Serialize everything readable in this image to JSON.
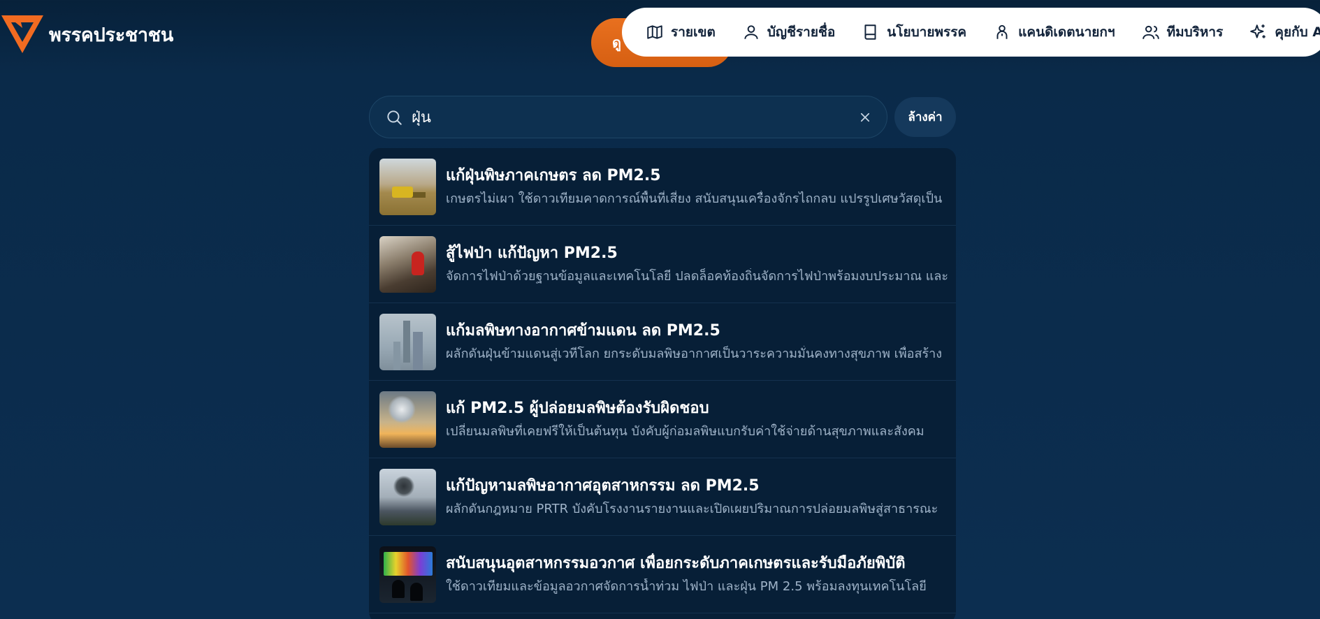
{
  "brand": {
    "name": "พรรคประชาชน",
    "accent": "#f26b21"
  },
  "cta": {
    "label": "ดู"
  },
  "nav": {
    "items": [
      {
        "label": "รายเขต",
        "icon": "map-icon"
      },
      {
        "label": "บัญชีรายชื่อ",
        "icon": "user-icon"
      },
      {
        "label": "นโยบายพรรค",
        "icon": "book-icon"
      },
      {
        "label": "แคนดิเดตนายกฯ",
        "icon": "person-icon"
      },
      {
        "label": "ทีมบริหาร",
        "icon": "users-icon"
      },
      {
        "label": "คุยกับ AI",
        "icon": "sparkles-icon"
      }
    ]
  },
  "search": {
    "value": "ฝุ่น",
    "clear_icon": "close-icon",
    "reset_label": "ล้างค่า"
  },
  "results": [
    {
      "title": "แก้ฝุ่นพิษภาคเกษตร ลด PM2.5",
      "desc": "เกษตรไม่เผา ใช้ดาวเทียมคาดการณ์พื้นที่เสี่ยง สนับสนุนเครื่องจักรไถกลบ แปรรูปเศษวัสดุเป็น",
      "thumb": "agriculture-harvester"
    },
    {
      "title": "สู้ไฟป่า แก้ปัญหา PM2.5",
      "desc": "จัดการไฟป่าด้วยฐานข้อมูลและเทคโนโลยี ปลดล็อคท้องถิ่นจัดการไฟป่าพร้อมงบประมาณ และ",
      "thumb": "forest-fire-fighter"
    },
    {
      "title": "แก้มลพิษทางอากาศข้ามแดน ลด PM2.5",
      "desc": "ผลักดันฝุ่นข้ามแดนสู่เวทีโลก ยกระดับมลพิษอากาศเป็นวาระความมั่นคงทางสุขภาพ เพื่อสร้าง",
      "thumb": "hazy-city-skyline"
    },
    {
      "title": "แก้ PM2.5 ผู้ปล่อยมลพิษต้องรับผิดชอบ",
      "desc": "เปลี่ยนมลพิษที่เคยฟรีให้เป็นต้นทุน บังคับผู้ก่อมลพิษแบกรับค่าใช้จ่ายด้านสุขภาพและสังคม",
      "thumb": "smokestack-sunset"
    },
    {
      "title": "แก้ปัญหามลพิษอากาศอุตสาหกรรม ลด PM2.5",
      "desc": "ผลักดันกฎหมาย PRTR บังคับโรงงานรายงานและเปิดเผยปริมาณการปล่อยมลพิษสู่สาธารณะ",
      "thumb": "factory-smoke"
    },
    {
      "title": "สนับสนุนอุตสาหกรรมอวกาศ เพื่อยกระดับภาคเกษตรและรับมือภัยพิบัติ",
      "desc": "ใช้ดาวเทียมและข้อมูลอวกาศจัดการน้ำท่วม ไฟป่า และฝุ่น PM 2.5 พร้อมลงทุนเทคโนโลยี",
      "thumb": "satellite-control-room"
    }
  ]
}
